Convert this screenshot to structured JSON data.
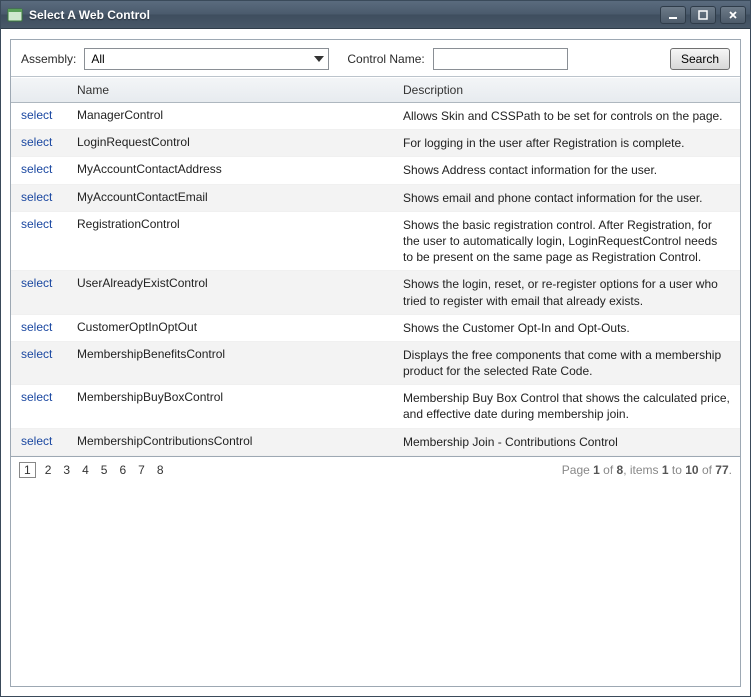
{
  "window": {
    "title": "Select A Web Control"
  },
  "filter": {
    "assembly_label": "Assembly:",
    "assembly_value": "All",
    "control_name_label": "Control Name:",
    "control_name_value": "",
    "search_label": "Search"
  },
  "grid": {
    "headers": {
      "select": "",
      "name": "Name",
      "description": "Description"
    },
    "select_label": "select",
    "rows": [
      {
        "name": "ManagerControl",
        "description": "Allows Skin and CSSPath to be set for controls on the page."
      },
      {
        "name": "LoginRequestControl",
        "description": "For logging in the user after Registration is complete."
      },
      {
        "name": "MyAccountContactAddress",
        "description": "Shows Address contact information for the user."
      },
      {
        "name": "MyAccountContactEmail",
        "description": "Shows email and phone contact information for the user."
      },
      {
        "name": "RegistrationControl",
        "description": "Shows the basic registration control. After Registration, for the user to automatically login, LoginRequestControl needs to be present on the same page as Registration Control."
      },
      {
        "name": "UserAlreadyExistControl",
        "description": "Shows the login, reset, or re-register options for a user who tried to register with email that already exists."
      },
      {
        "name": "CustomerOptInOptOut",
        "description": "Shows the Customer Opt-In and Opt-Outs."
      },
      {
        "name": "MembershipBenefitsControl",
        "description": "Displays the free components that come with a membership product for the selected Rate Code."
      },
      {
        "name": "MembershipBuyBoxControl",
        "description": "Membership Buy Box Control that shows the calculated price, and effective date during membership join."
      },
      {
        "name": "MembershipContributionsControl",
        "description": "Membership Join - Contributions Control"
      }
    ]
  },
  "pager": {
    "pages": [
      "1",
      "2",
      "3",
      "4",
      "5",
      "6",
      "7",
      "8"
    ],
    "current": "1",
    "summary_prefix": "Page ",
    "page": "1",
    "of_label": " of ",
    "total_pages": "8",
    "items_label": ", items ",
    "from": "1",
    "to_label": " to ",
    "to": "10",
    "of2_label": " of ",
    "total_items": "77",
    "dot": "."
  }
}
